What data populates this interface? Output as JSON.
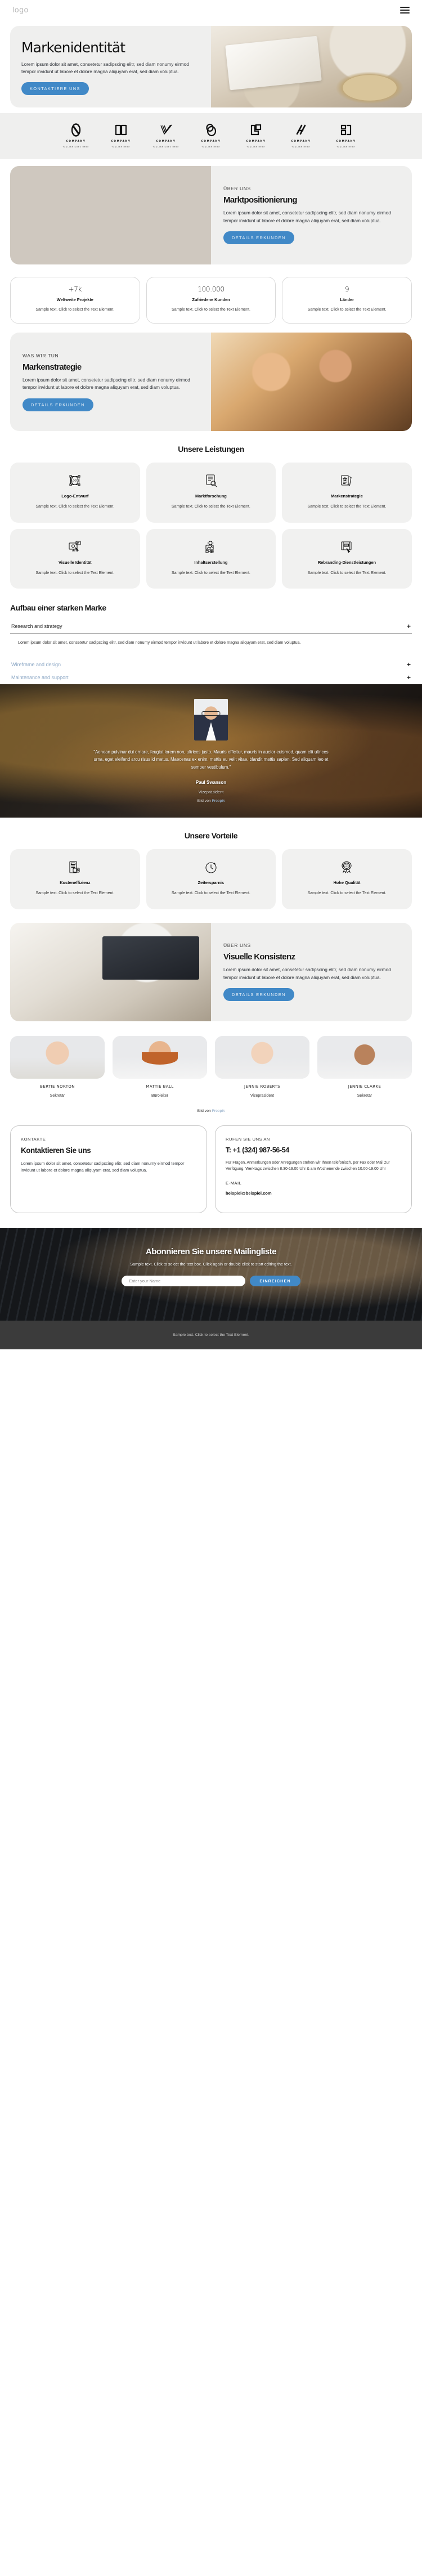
{
  "header": {
    "logo": "logo",
    "menu_icon": "hamburger-icon"
  },
  "hero": {
    "title": "Markenidentität",
    "text": "Lorem ipsum dolor sit amet, consetetur sadipscing elitr, sed diam nonumy eirmod tempor invidunt ut labore et dolore magna aliquyam erat, sed diam voluptua.",
    "cta": "KONTAKTIERE UNS"
  },
  "clients": [
    {
      "name": "COMPANY",
      "tagline": "TAGLINE GOES HERE",
      "icon": "oval-logo-icon"
    },
    {
      "name": "COMPANY",
      "tagline": "TAGLINE HERE",
      "icon": "book-logo-icon"
    },
    {
      "name": "COMPANY",
      "tagline": "TAGLINE GOES HERE",
      "icon": "checkmark-lines-logo-icon"
    },
    {
      "name": "COMPANY",
      "tagline": "TAGLINE HERE",
      "icon": "double-circle-logo-icon"
    },
    {
      "name": "COMPANY",
      "tagline": "TAGLINE HERE",
      "icon": "square-corner-logo-icon"
    },
    {
      "name": "COMPANY",
      "tagline": "TAGLINE HERE",
      "icon": "diagonal-slashes-logo-icon"
    },
    {
      "name": "COMPANY",
      "tagline": "TAGLINE HERE",
      "icon": "letter-block-logo-icon"
    }
  ],
  "about": {
    "eyebrow": "ÜBER UNS",
    "title": "Marktpositionierung",
    "text": "Lorem ipsum dolor sit amet, consetetur sadipscing elitr, sed diam nonumy eirmod tempor invidunt ut labore et dolore magna aliquyam erat, sed diam voluptua.",
    "cta": "DETAILS ERKUNDEN"
  },
  "stats": [
    {
      "number": "+7k",
      "label": "Weltweite Projekte",
      "desc": "Sample text. Click to select the Text Element."
    },
    {
      "number": "100.000",
      "label": "Zufriedene Kunden",
      "desc": "Sample text. Click to select the Text Element."
    },
    {
      "number": "9",
      "label": "Länder",
      "desc": "Sample text. Click to select the Text Element."
    }
  ],
  "strategy": {
    "eyebrow": "WAS WIR TUN",
    "title": "Markenstrategie",
    "text": "Lorem ipsum dolor sit amet, consetetur sadipscing elitr, sed diam nonumy eirmod tempor invidunt ut labore et dolore magna aliquyam erat, sed diam voluptua.",
    "cta": "DETAILS ERKUNDEN"
  },
  "services": {
    "title": "Unsere Leistungen",
    "items": [
      {
        "title": "Logo-Entwurf",
        "desc": "Sample text. Click to select the Text Element.",
        "icon": "logo-design-icon"
      },
      {
        "title": "Marktforschung",
        "desc": "Sample text. Click to select the Text Element.",
        "icon": "market-research-icon"
      },
      {
        "title": "Markenstrategie",
        "desc": "Sample text. Click to select the Text Element.",
        "icon": "brand-strategy-icon"
      },
      {
        "title": "Visuelle Identität",
        "desc": "Sample text. Click to select the Text Element.",
        "icon": "visual-identity-icon"
      },
      {
        "title": "Inhaltserstellung",
        "desc": "Sample text. Click to select the Text Element.",
        "icon": "content-creation-icon"
      },
      {
        "title": "Rebranding-Dienstleistungen",
        "desc": "Sample text. Click to select the Text Element.",
        "icon": "rebranding-icon"
      }
    ]
  },
  "accordion": {
    "title": "Aufbau einer starken Marke",
    "items": [
      {
        "label": "Research and strategy",
        "open": true,
        "body": "Lorem ipsum dolor sit amet, consetetur sadipscing elitr, sed diam nonumy eirmod tempor invidunt ut labore et dolore magna aliquyam erat, sed diam voluptua.",
        "toggle": "+"
      },
      {
        "label": "Wireframe and design",
        "open": false,
        "body": "",
        "toggle": "+"
      },
      {
        "label": "Maintenance and support",
        "open": false,
        "body": "",
        "toggle": "+"
      }
    ]
  },
  "testimonial": {
    "quote": "\"Aenean pulvinar dui ornare, feugiat lorem non, ultrices justo. Mauris efficitur, mauris in auctor euismod, quam elit ultrices urna, eget eleifend arcu risus id metus. Maecenas ex enim, mattis eu velit vitae, blandit mattis sapien. Sed aliquam leo et semper vestibulum.\"",
    "name": "Paul Swanson",
    "role": "Vizepräsident",
    "credit_prefix": "Bild von ",
    "credit_link": "Freepik"
  },
  "benefits": {
    "title": "Unsere Vorteile",
    "items": [
      {
        "title": "Kosteneffizienz",
        "desc": "Sample text. Click to select the Text Element.",
        "icon": "cost-efficiency-icon"
      },
      {
        "title": "Zeitersparnis",
        "desc": "Sample text. Click to select the Text Element.",
        "icon": "stopwatch-icon"
      },
      {
        "title": "Hohe Qualität",
        "desc": "Sample text. Click to select the Text Element.",
        "icon": "high-quality-badge-icon"
      }
    ]
  },
  "consistency": {
    "eyebrow": "ÜBER UNS",
    "title": "Visuelle Konsistenz",
    "text": "Lorem ipsum dolor sit amet, consetetur sadipscing elitr, sed diam nonumy eirmod tempor invidunt ut labore et dolore magna aliquyam erat, sed diam voluptua.",
    "cta": "DETAILS ERKUNDEN"
  },
  "team": {
    "members": [
      {
        "name": "BERTIE NORTON",
        "role": "Sekretär"
      },
      {
        "name": "MATTIE BALL",
        "role": "Büroleiter"
      },
      {
        "name": "JENNIE ROBERTS",
        "role": "Vizepräsident"
      },
      {
        "name": "JENNIE CLARKE",
        "role": "Sekretär"
      }
    ],
    "credit_prefix": "Bild von ",
    "credit_link": "Freepik"
  },
  "contact": {
    "left": {
      "eyebrow": "KONTAKTE",
      "title": "Kontaktieren Sie uns",
      "text": "Lorem ipsum dolor sit amet, consetetur sadipscing elitr, sed diam nonumy eirmod tempor invidunt ut labore et dolore magna aliquyam erat, sed diam voluptua."
    },
    "right": {
      "eyebrow": "RUFEN SIE UNS AN",
      "phone": "T: +1 (324) 987-56-54",
      "hours": "Für Fragen, Anmerkungen oder Anregungen stehen wir Ihnen telefonisch, per Fax oder Mail zur Verfügung. Werktags zwischen 8.30-19.00 Uhr & am Wochenende zwischen 10.00-19.00 Uhr",
      "mail_label": "E-MAIL",
      "mail": "beispiel@beispiel.com"
    }
  },
  "newsletter": {
    "title": "Abonnieren Sie unsere Mailingliste",
    "subtitle": "Sample text. Click to select the text box. Click again or double click to start editing the text.",
    "placeholder": "Enter your Name",
    "button": "EINREICHEN"
  },
  "footer": {
    "text": "Sample text. Click to select the Text Element."
  },
  "colors": {
    "accent": "#4189c7",
    "surface": "#efefee",
    "footer_bg": "#3b3b3b"
  }
}
